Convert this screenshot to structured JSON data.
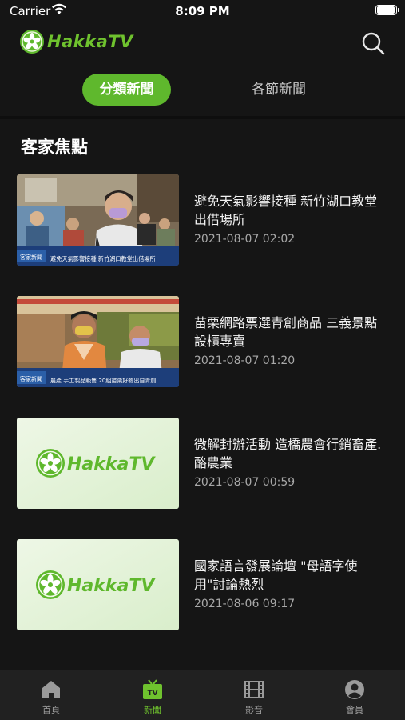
{
  "status_bar": {
    "carrier": "Carrier",
    "time": "8:09 PM",
    "battery_level": 0.95
  },
  "header": {
    "logo_text": "HakkaTV",
    "search_icon": "search-icon"
  },
  "segments": [
    {
      "label": "分類新聞",
      "active": true
    },
    {
      "label": "各節新聞",
      "active": false
    }
  ],
  "section": {
    "title": "客家焦點"
  },
  "news": [
    {
      "title": "避免天氣影響接種 新竹湖口教堂出借場所",
      "date": "2021-08-07 02:02",
      "caption": "避免天氣影響接種 新竹湖口教堂出借場所",
      "thumb_type": "photo"
    },
    {
      "title": "苗栗網路票選青創商品 三義景點設櫃專賣",
      "date": "2021-08-07 01:20",
      "caption": "農產.手工製品販售 20組苗栗好物出自青創",
      "thumb_type": "photo"
    },
    {
      "title": "微解封辦活動 造橋農會行銷畜產.酪農業",
      "date": "2021-08-07 00:59",
      "thumb_logo_text": "HakkaTV",
      "thumb_type": "logo"
    },
    {
      "title": "國家語言發展論壇 \"母語字使用\"討論熱烈",
      "date": "2021-08-06 09:17",
      "thumb_logo_text": "HakkaTV",
      "thumb_type": "logo"
    }
  ],
  "tabbar": [
    {
      "label": "首頁",
      "icon": "home-icon",
      "active": false
    },
    {
      "label": "新聞",
      "icon": "tv-news-icon",
      "active": true
    },
    {
      "label": "影音",
      "icon": "film-icon",
      "active": false
    },
    {
      "label": "會員",
      "icon": "user-icon",
      "active": false
    }
  ],
  "colors": {
    "accent": "#5fb82d",
    "background": "#151515",
    "tabbar": "#212121"
  }
}
